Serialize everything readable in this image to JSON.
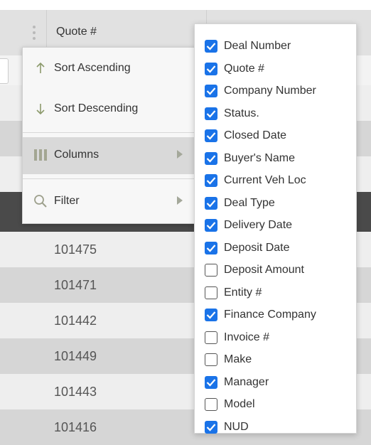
{
  "grid": {
    "header": {
      "column_label": "Quote #"
    },
    "rows": [
      {
        "quote": "101475"
      },
      {
        "quote": "101471"
      },
      {
        "quote": "101442"
      },
      {
        "quote": "101449"
      },
      {
        "quote": "101443"
      },
      {
        "quote": "101416"
      }
    ]
  },
  "column_menu": {
    "items": [
      {
        "label": "Sort Ascending",
        "icon": "arrow-up-icon"
      },
      {
        "label": "Sort Descending",
        "icon": "arrow-down-icon"
      },
      {
        "label": "Columns",
        "icon": "columns-icon",
        "active": true
      },
      {
        "label": "Filter",
        "icon": "search-icon"
      }
    ]
  },
  "columns_panel": {
    "checkbox_color": "#1a73e8",
    "items": [
      {
        "label": "Deal Number",
        "checked": true
      },
      {
        "label": "Quote #",
        "checked": true
      },
      {
        "label": "Company Number",
        "checked": true
      },
      {
        "label": "Status.",
        "checked": true
      },
      {
        "label": "Closed Date",
        "checked": true
      },
      {
        "label": "Buyer's Name",
        "checked": true
      },
      {
        "label": "Current Veh Loc",
        "checked": true
      },
      {
        "label": "Deal Type",
        "checked": true
      },
      {
        "label": "Delivery Date",
        "checked": true
      },
      {
        "label": "Deposit Date",
        "checked": true
      },
      {
        "label": "Deposit Amount",
        "checked": false
      },
      {
        "label": "Entity #",
        "checked": false
      },
      {
        "label": "Finance Company",
        "checked": true
      },
      {
        "label": "Invoice #",
        "checked": false
      },
      {
        "label": "Make",
        "checked": false
      },
      {
        "label": "Manager",
        "checked": true
      },
      {
        "label": "Model",
        "checked": false
      },
      {
        "label": "NUD",
        "checked": true
      }
    ]
  }
}
